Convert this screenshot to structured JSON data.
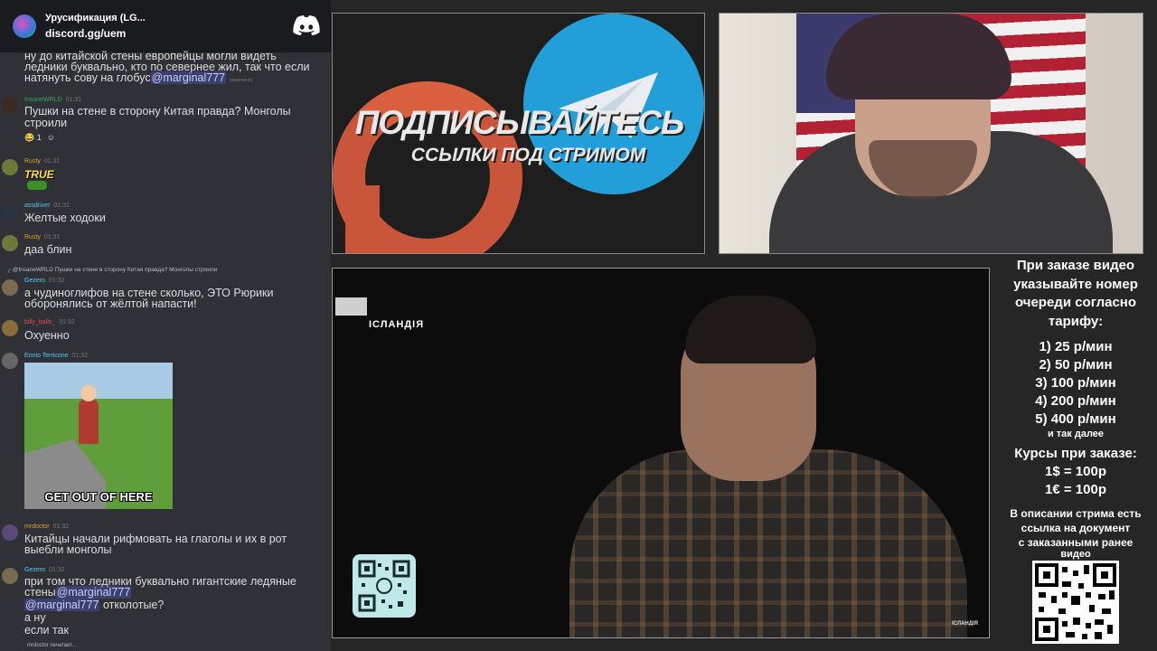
{
  "chat": {
    "server_name": "Урусификация (LG...",
    "server_link": "discord.gg/uem",
    "logo_icon": "discord-icon",
    "messages": [
      {
        "text_line1": "ну до китайской стены европейцы могли видеть",
        "text_line2": "ледники буквально, кто по севернее жил, так что если",
        "text_line3": "натянуть сову на глобус",
        "mention": "@marginal777",
        "edited": "(изменено)"
      },
      {
        "user": "InsaneWRLD",
        "time": "01:31",
        "text_line1": "Пушки на стене в сторону Китая правда? Монголы",
        "text_line2": "строили",
        "reaction1": "😂 1",
        "reaction2": "☺"
      },
      {
        "user": "Rusty",
        "time": "01:31",
        "sticker": "TRUE"
      },
      {
        "user": "assdriver",
        "time": "01:31",
        "text_line1": "Желтые ходоки"
      },
      {
        "user": "Rusty",
        "time": "01:31",
        "text_line1": "даа блин"
      },
      {
        "reply": "@InsaneWRLD Пушки на стене в сторону Китая правда? Монголы строили",
        "user": "Gezero",
        "time": "01:32",
        "text_line1": "а чудиноглифов на стене сколько, ЭТО Рюрики",
        "text_line2": "оборонялись от жёлтой напасти!"
      },
      {
        "user": "billy_balls_",
        "time": "01:32",
        "text_line1": "Охуенно"
      },
      {
        "user": "Ennio Terricone",
        "time": "01:32",
        "gif_caption": "GET OUT OF HERE"
      },
      {
        "user": "mrdoctor",
        "time": "01:32",
        "text_line1": "Китайцы начали рифмовать на глаголы и их в рот",
        "text_line2": "выебли монголы"
      },
      {
        "user": "Gezero",
        "time": "01:32",
        "text_line1": "при том что ледники буквально гигантские ледяные",
        "text_line2_pre": "стены",
        "mention1": "@marginal777",
        "mention2": "@marginal777",
        "text_line3_post": " отколотые?",
        "text_line4": "а ну",
        "text_line5": "если так"
      }
    ],
    "typing": "mrdoctor печатает..."
  },
  "promo": {
    "headline": "ПОДПИСЫВАЙТЕСЬ",
    "subline": "ССЫЛКИ ПОД СТРИМОМ"
  },
  "video": {
    "channel": "ІСЛАНДІЯ",
    "logo": "ІСЛАНДІЯ"
  },
  "info": {
    "intro": [
      "При заказе видео",
      "указывайте номер",
      "очереди согласно",
      "тарифу:"
    ],
    "prices": [
      "1) 25 р/мин",
      "2) 50 р/мин",
      "3) 100 р/мин",
      "4) 200 р/мин",
      "5) 400 р/мин"
    ],
    "etc": "и так далее",
    "rates_title": "Курсы при заказе:",
    "rates": [
      "1$ = 100р",
      "1€ = 100р"
    ],
    "desc": [
      "В описании стрима есть",
      "ссылка на документ",
      "с заказанными ранее",
      "видео"
    ]
  }
}
